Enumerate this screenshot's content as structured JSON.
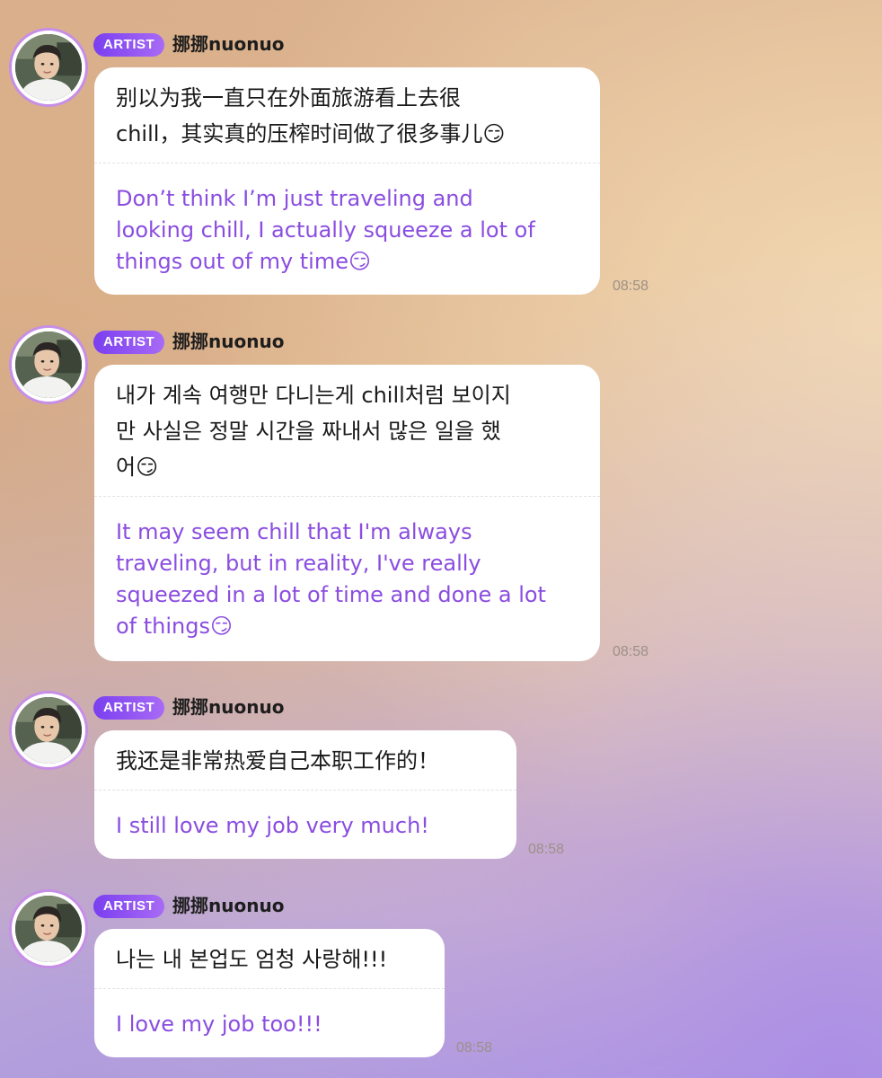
{
  "messages": [
    {
      "badge": "ARTIST",
      "name": "挪挪nuonuo",
      "original": "别以为我一直只在外面旅游看上去很\nchill，其实真的压榨时间做了很多事儿😏",
      "translation": "Don’t think I’m just traveling and\nlooking chill, I actually squeeze a lot of\nthings out of my time😏",
      "time": "08:58"
    },
    {
      "badge": "ARTIST",
      "name": "挪挪nuonuo",
      "original": "내가 계속 여행만 다니는게 chill처럼 보이지\n만 사실은 정말 시간을 짜내서 많은 일을 했\n어😏",
      "translation": "It may seem chill that I'm always\ntraveling, but in reality, I've really\nsqueezed in a lot of time and done a lot\nof things😏",
      "time": "08:58"
    },
    {
      "badge": "ARTIST",
      "name": "挪挪nuonuo",
      "original": "我还是非常热爱自己本职工作的！",
      "translation": "I still love my job very much!",
      "time": "08:58"
    },
    {
      "badge": "ARTIST",
      "name": "挪挪nuonuo",
      "original": "나는 내 본업도 엄청 사랑해!!!",
      "translation": "I love my job too!!!",
      "time": "08:58"
    }
  ]
}
